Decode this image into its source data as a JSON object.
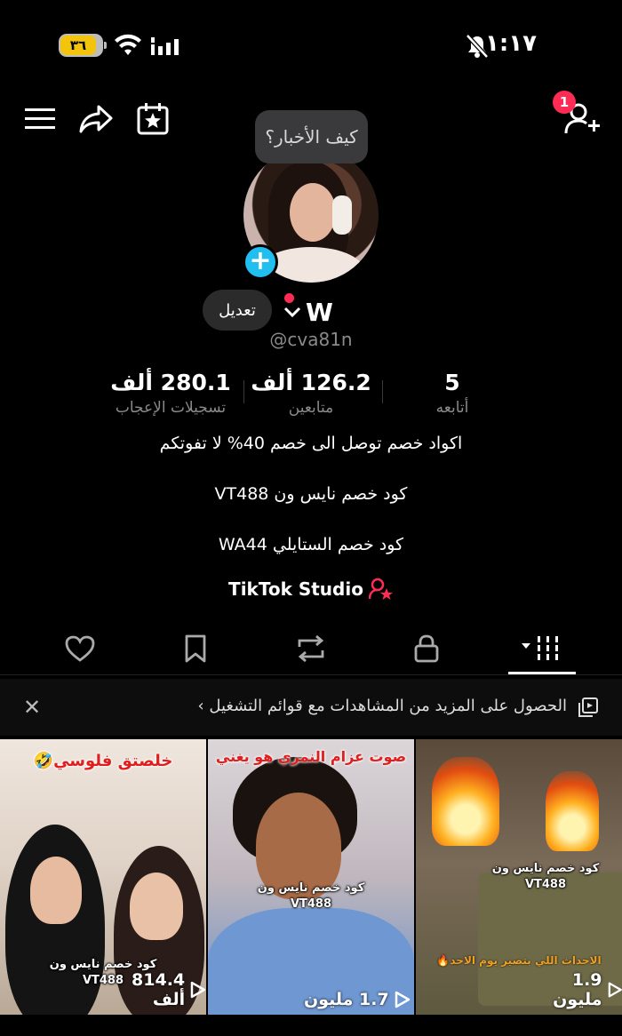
{
  "status_bar": {
    "battery_level": "٣٦",
    "clock": "١:١٧"
  },
  "profile": {
    "bubble_note": "كيف الأخبار؟",
    "edit_label": "تعديل",
    "display_name": "W",
    "username": "@cva81n",
    "notification_count": "1"
  },
  "stats": {
    "likes_value": "280.1 ألف",
    "likes_label": "تسجيلات الإعجاب",
    "followers_value": "126.2 ألف",
    "followers_label": "متابعين",
    "following_value": "5",
    "following_label": "أتابعه"
  },
  "bio": {
    "line1": "اكواد خصم توصل الى خصم 40% لا تفوتكم",
    "line2": "كود خصم نايس ون VT488",
    "line3": "كود خصم الستايلي  WA44",
    "studio_link": "TikTok Studio"
  },
  "banner": {
    "text": "الحصول على المزيد من المشاهدات مع قوائم التشغيل ›"
  },
  "videos": [
    {
      "title": "خلصتق فلوسي🤣",
      "promo_line1": "كود خصم نايس ون",
      "promo_line2": "VT488",
      "views": "814.4 ألف"
    },
    {
      "title": "صوت عزام النمري هو يغني",
      "promo_line1": "كود خصم نايس ون",
      "promo_line2": "VT488",
      "views": "1.7 مليون"
    },
    {
      "title": "الاحداث اللي بتصير يوم الاحد🔥",
      "promo_line1": "كود خصم نايس ون",
      "promo_line2": "VT488",
      "views": "1.9 مليون"
    }
  ],
  "colors": {
    "accent_red": "#fe2c55",
    "avatar_add_blue": "#20bff0",
    "battery_yellow": "#f2c40d"
  },
  "icons": [
    "menu-icon",
    "share-icon",
    "calendar-star-icon",
    "add-friend-icon",
    "heart-icon",
    "bookmark-icon",
    "repost-icon",
    "lock-icon",
    "grid-icon",
    "playlist-icon",
    "close-icon",
    "play-icon"
  ]
}
